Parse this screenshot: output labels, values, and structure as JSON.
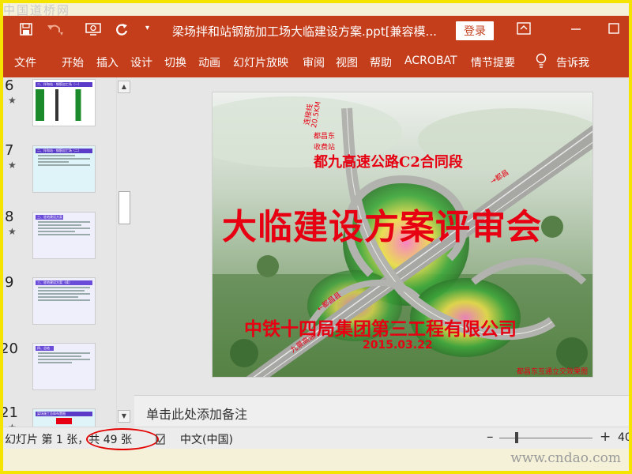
{
  "watermark_top": "中国道桥网",
  "watermark_bottom": "www.cndao.com",
  "titlebar": {
    "title": "梁场拌和站钢筋加工场大临建设方案.ppt[兼容模...",
    "login": "登录",
    "icons": [
      "save-icon",
      "undo-icon",
      "present-icon",
      "redo-icon",
      "customize-icon",
      "ribbon-display-icon",
      "maximize-icon"
    ]
  },
  "ribbon": {
    "tabs": [
      "文件",
      "开始",
      "插入",
      "设计",
      "切换",
      "动画",
      "幻灯片放映",
      "审阅",
      "视图",
      "帮助",
      "ACROBAT",
      "情节提要"
    ],
    "tell_me": "告诉我"
  },
  "thumbnails": [
    {
      "number": "6",
      "star": "★",
      "title": "二、拌和站 · 钢筋加工场（一）"
    },
    {
      "number": "7",
      "star": "★",
      "title": "二、拌和站 · 钢筋加工场（二）"
    },
    {
      "number": "8",
      "star": "★",
      "title": "三、驻地建设方案"
    },
    {
      "number": "9",
      "star": "",
      "title": "三、驻地建设方案（续）"
    },
    {
      "number": "20",
      "star": "",
      "title": "四、总结"
    },
    {
      "number": "21",
      "star": "★",
      "title": "梁场施工总体布置图"
    }
  ],
  "slide": {
    "subtitle": "都九高速公路C2合同段",
    "main_title": "大临建设方案评审会",
    "organization": "中铁十四局集团第三工程有限公司",
    "date": "2015.03.22",
    "caption": "都昌东互通立交效果图",
    "road_labels": [
      "连接线",
      "20.5KM",
      "都昌东",
      "收费站",
      "→都昌",
      "九景高速",
      "←都昌县"
    ]
  },
  "notes": {
    "placeholder": "单击此处添加备注"
  },
  "status": {
    "slide_info": "幻灯片 第 1 张，共 49 张",
    "language": "中文(中国)",
    "zoom": "40"
  },
  "colors": {
    "accent": "#c43e1c",
    "slide_text": "#e60012",
    "frame": "#f5e400"
  }
}
